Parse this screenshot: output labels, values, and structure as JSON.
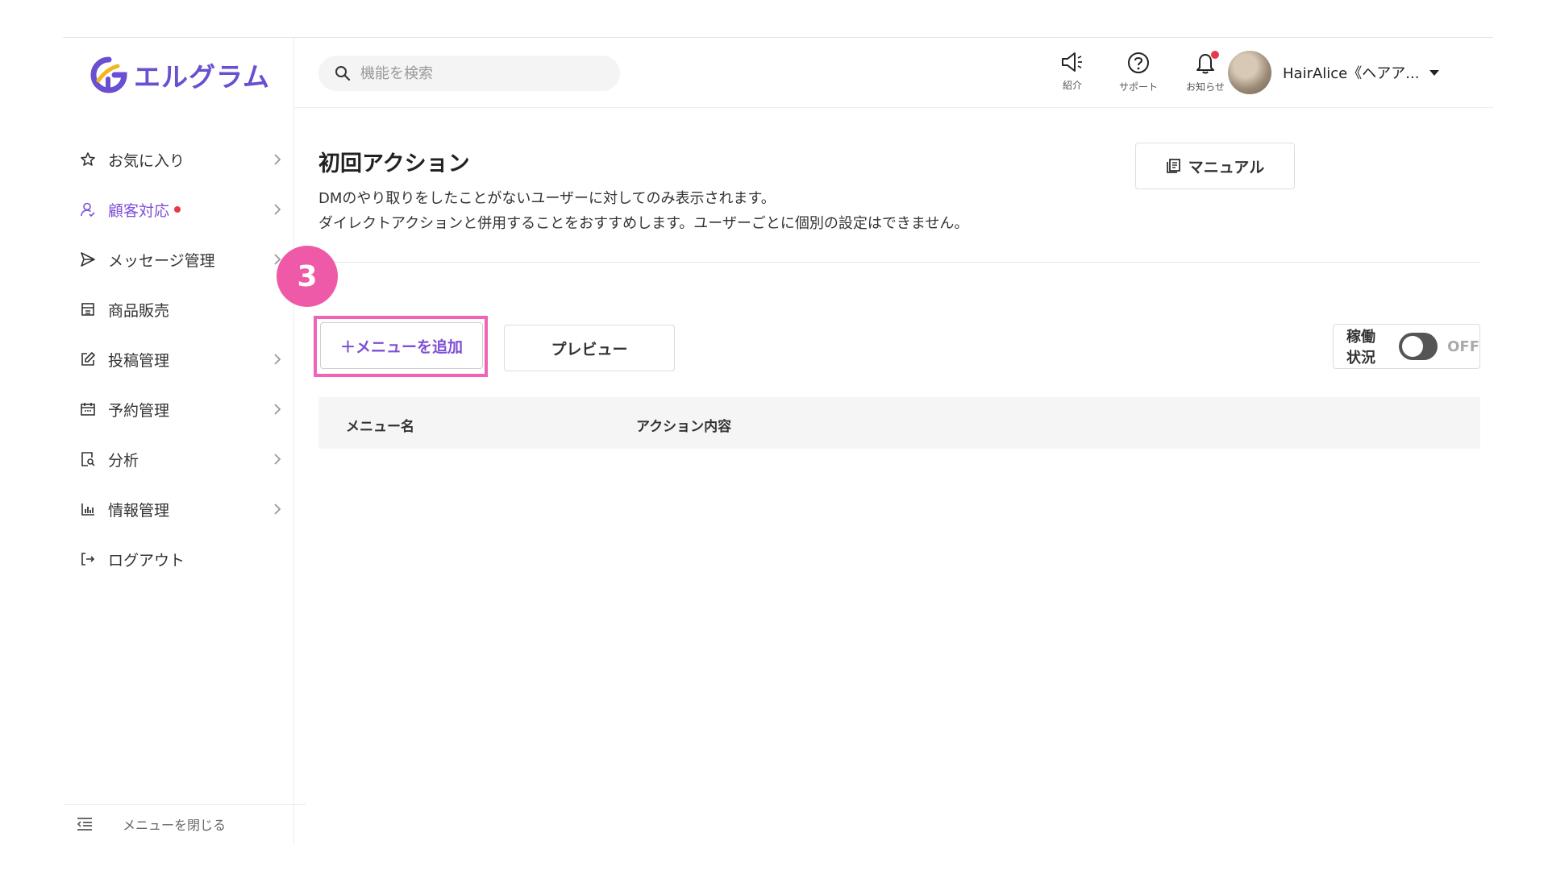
{
  "app": {
    "logo_text": "エルグラム",
    "brand_color": "#6a4fd1",
    "accent_pink": "#ef63b8"
  },
  "search": {
    "placeholder": "機能を検索"
  },
  "header": {
    "icons": [
      {
        "name": "megaphone-icon",
        "label": "紹介"
      },
      {
        "name": "question-icon",
        "label": "サポート"
      },
      {
        "name": "bell-icon",
        "label": "お知らせ",
        "has_dot": true
      }
    ],
    "user_name": "HairAlice《ヘアア..."
  },
  "sidebar": {
    "items": [
      {
        "label": "お気に入り",
        "icon": "star-icon",
        "chevron": true
      },
      {
        "label": "顧客対応",
        "icon": "person-icon",
        "chevron": true,
        "active": true,
        "dot": true
      },
      {
        "label": "メッセージ管理",
        "icon": "send-icon",
        "chevron": true
      },
      {
        "label": "商品販売",
        "icon": "store-icon",
        "chevron": false
      },
      {
        "label": "投稿管理",
        "icon": "edit-icon",
        "chevron": true
      },
      {
        "label": "予約管理",
        "icon": "calendar-icon",
        "chevron": true
      },
      {
        "label": "分析",
        "icon": "analysis-icon",
        "chevron": true
      },
      {
        "label": "情報管理",
        "icon": "chart-icon",
        "chevron": true
      },
      {
        "label": "ログアウト",
        "icon": "logout-icon",
        "chevron": false
      }
    ],
    "collapse_label": "メニューを閉じる"
  },
  "main": {
    "title": "初回アクション",
    "desc_line1": "DMのやり取りをしたことがないユーザーに対してのみ表示されます。",
    "desc_line2": "ダイレクトアクションと併用することをおすすめします。ユーザーごとに個別の設定はできません。",
    "manual_label": "マニュアル",
    "step_number": "3",
    "add_menu_label": "＋メニューを追加",
    "preview_label": "プレビュー",
    "status_label": "稼働状況",
    "toggle_state": "OFF",
    "table_headers": [
      "メニュー名",
      "アクション内容"
    ]
  }
}
